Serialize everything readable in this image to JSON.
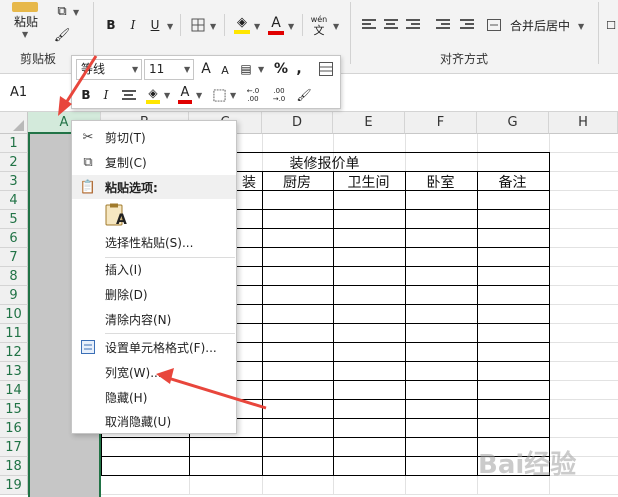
{
  "ribbon": {
    "paste_label": "粘贴",
    "clipboard_group": "剪贴板",
    "bold": "B",
    "italic": "I",
    "underline": "U",
    "font_color_glyph": "A",
    "phonetic_top": "wén",
    "phonetic_bottom": "文",
    "merge_label": "合并后居中",
    "alignment_group": "对齐方式"
  },
  "formula_bar": {
    "name_box": "A1"
  },
  "mini_toolbar": {
    "font_name": "等线",
    "font_size": "11",
    "grow_font": "A",
    "shrink_font": "A",
    "percent": "%",
    "comma": ",",
    "bold": "B",
    "italic": "I",
    "font_color_glyph": "A",
    "inc_decimal": "←.0 .00",
    "dec_decimal": ".00 →.0"
  },
  "sheet": {
    "columns": [
      "A",
      "B",
      "C",
      "D",
      "E",
      "F",
      "G",
      "H"
    ],
    "rows": [
      "1",
      "2",
      "3",
      "4",
      "5",
      "6",
      "7",
      "8",
      "9",
      "10",
      "11",
      "12",
      "13",
      "14",
      "15",
      "16",
      "17",
      "18",
      "19"
    ],
    "table_title": "装修报价单",
    "headers": {
      "c_partial": "装",
      "d": "厨房",
      "e": "卫生间",
      "f": "卧室",
      "g": "备注"
    }
  },
  "context_menu": {
    "items": [
      {
        "label": "剪切(T)",
        "icon": "scissors-icon"
      },
      {
        "label": "复制(C)",
        "icon": "copy-icon"
      },
      {
        "label": "粘贴选项:",
        "icon": "paste-icon"
      },
      {
        "label": "A",
        "icon": "paste-clipboard-icon"
      },
      {
        "label": "选择性粘贴(S)...",
        "icon": ""
      },
      {
        "label": "插入(I)",
        "icon": ""
      },
      {
        "label": "删除(D)",
        "icon": ""
      },
      {
        "label": "清除内容(N)",
        "icon": ""
      },
      {
        "label": "设置单元格格式(F)...",
        "icon": "format-cells-icon"
      },
      {
        "label": "列宽(W)...",
        "icon": ""
      },
      {
        "label": "隐藏(H)",
        "icon": ""
      },
      {
        "label": "取消隐藏(U)",
        "icon": ""
      }
    ]
  },
  "watermark": "Bai经验",
  "colors": {
    "excel_green": "#217346",
    "arrow_red": "#e8463c",
    "selection_gray": "#c6c6c6"
  }
}
